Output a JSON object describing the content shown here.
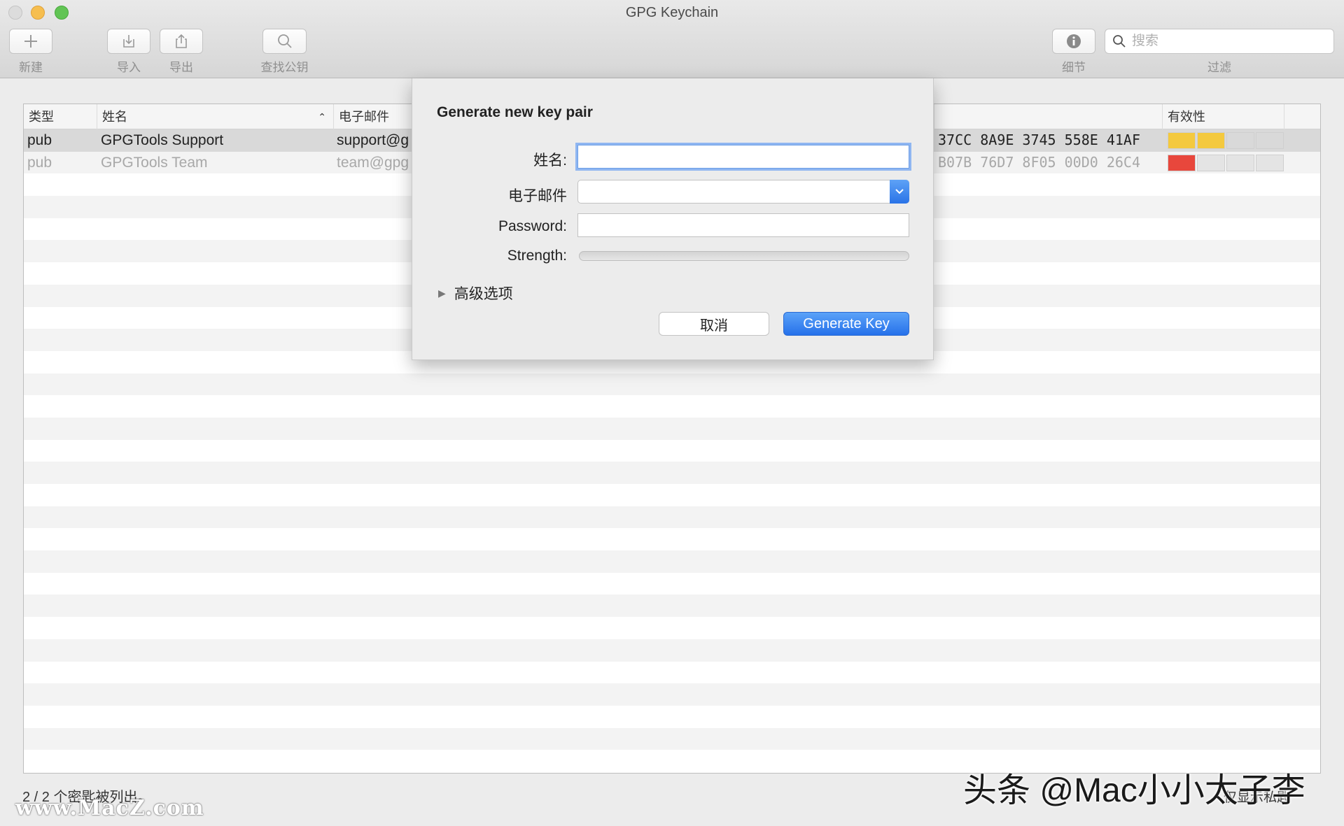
{
  "window": {
    "title": "GPG Keychain"
  },
  "toolbar": {
    "new_label": "新建",
    "import_label": "导入",
    "export_label": "导出",
    "lookup_label": "查找公钥",
    "details_label": "细节",
    "filter_label": "过滤",
    "search_placeholder": "搜索"
  },
  "table": {
    "columns": [
      {
        "label": "类型"
      },
      {
        "label": "姓名"
      },
      {
        "label": "电子邮件"
      },
      {
        "label": "有效性"
      }
    ],
    "rows": [
      {
        "type": "pub",
        "name": "GPGTools Support",
        "email": "support@g",
        "fingerprint": "37CC 8A9E 3745 558E 41AF",
        "validity_colors": [
          "#f4c93e",
          "#f4c93e",
          "#d9d9d9",
          "#d9d9d9"
        ],
        "selected": true,
        "dim": false
      },
      {
        "type": "pub",
        "name": "GPGTools Team",
        "email": "team@gpg",
        "fingerprint": "B07B 76D7 8F05 00D0 26C4",
        "validity_colors": [
          "#e8473c",
          "#e4e4e4",
          "#e4e4e4",
          "#e4e4e4"
        ],
        "selected": false,
        "dim": true
      }
    ]
  },
  "status": {
    "count_text": "2 / 2 个密匙被列出。",
    "right_text": "仅显示私匙"
  },
  "watermarks": {
    "left": "www.MacZ.com",
    "right": "头条 @Mac小小太子李"
  },
  "dialog": {
    "title": "Generate new key pair",
    "name_label": "姓名:",
    "name_value": "",
    "email_label": "电子邮件",
    "email_value": "",
    "password_label": "Password:",
    "password_value": "",
    "strength_label": "Strength:",
    "strength_value": 0,
    "advanced_label": "高级选项",
    "cancel_label": "取消",
    "generate_label": "Generate Key"
  },
  "colors": {
    "accent": "#2a73e7",
    "focus_ring": "#8fb6f1"
  }
}
